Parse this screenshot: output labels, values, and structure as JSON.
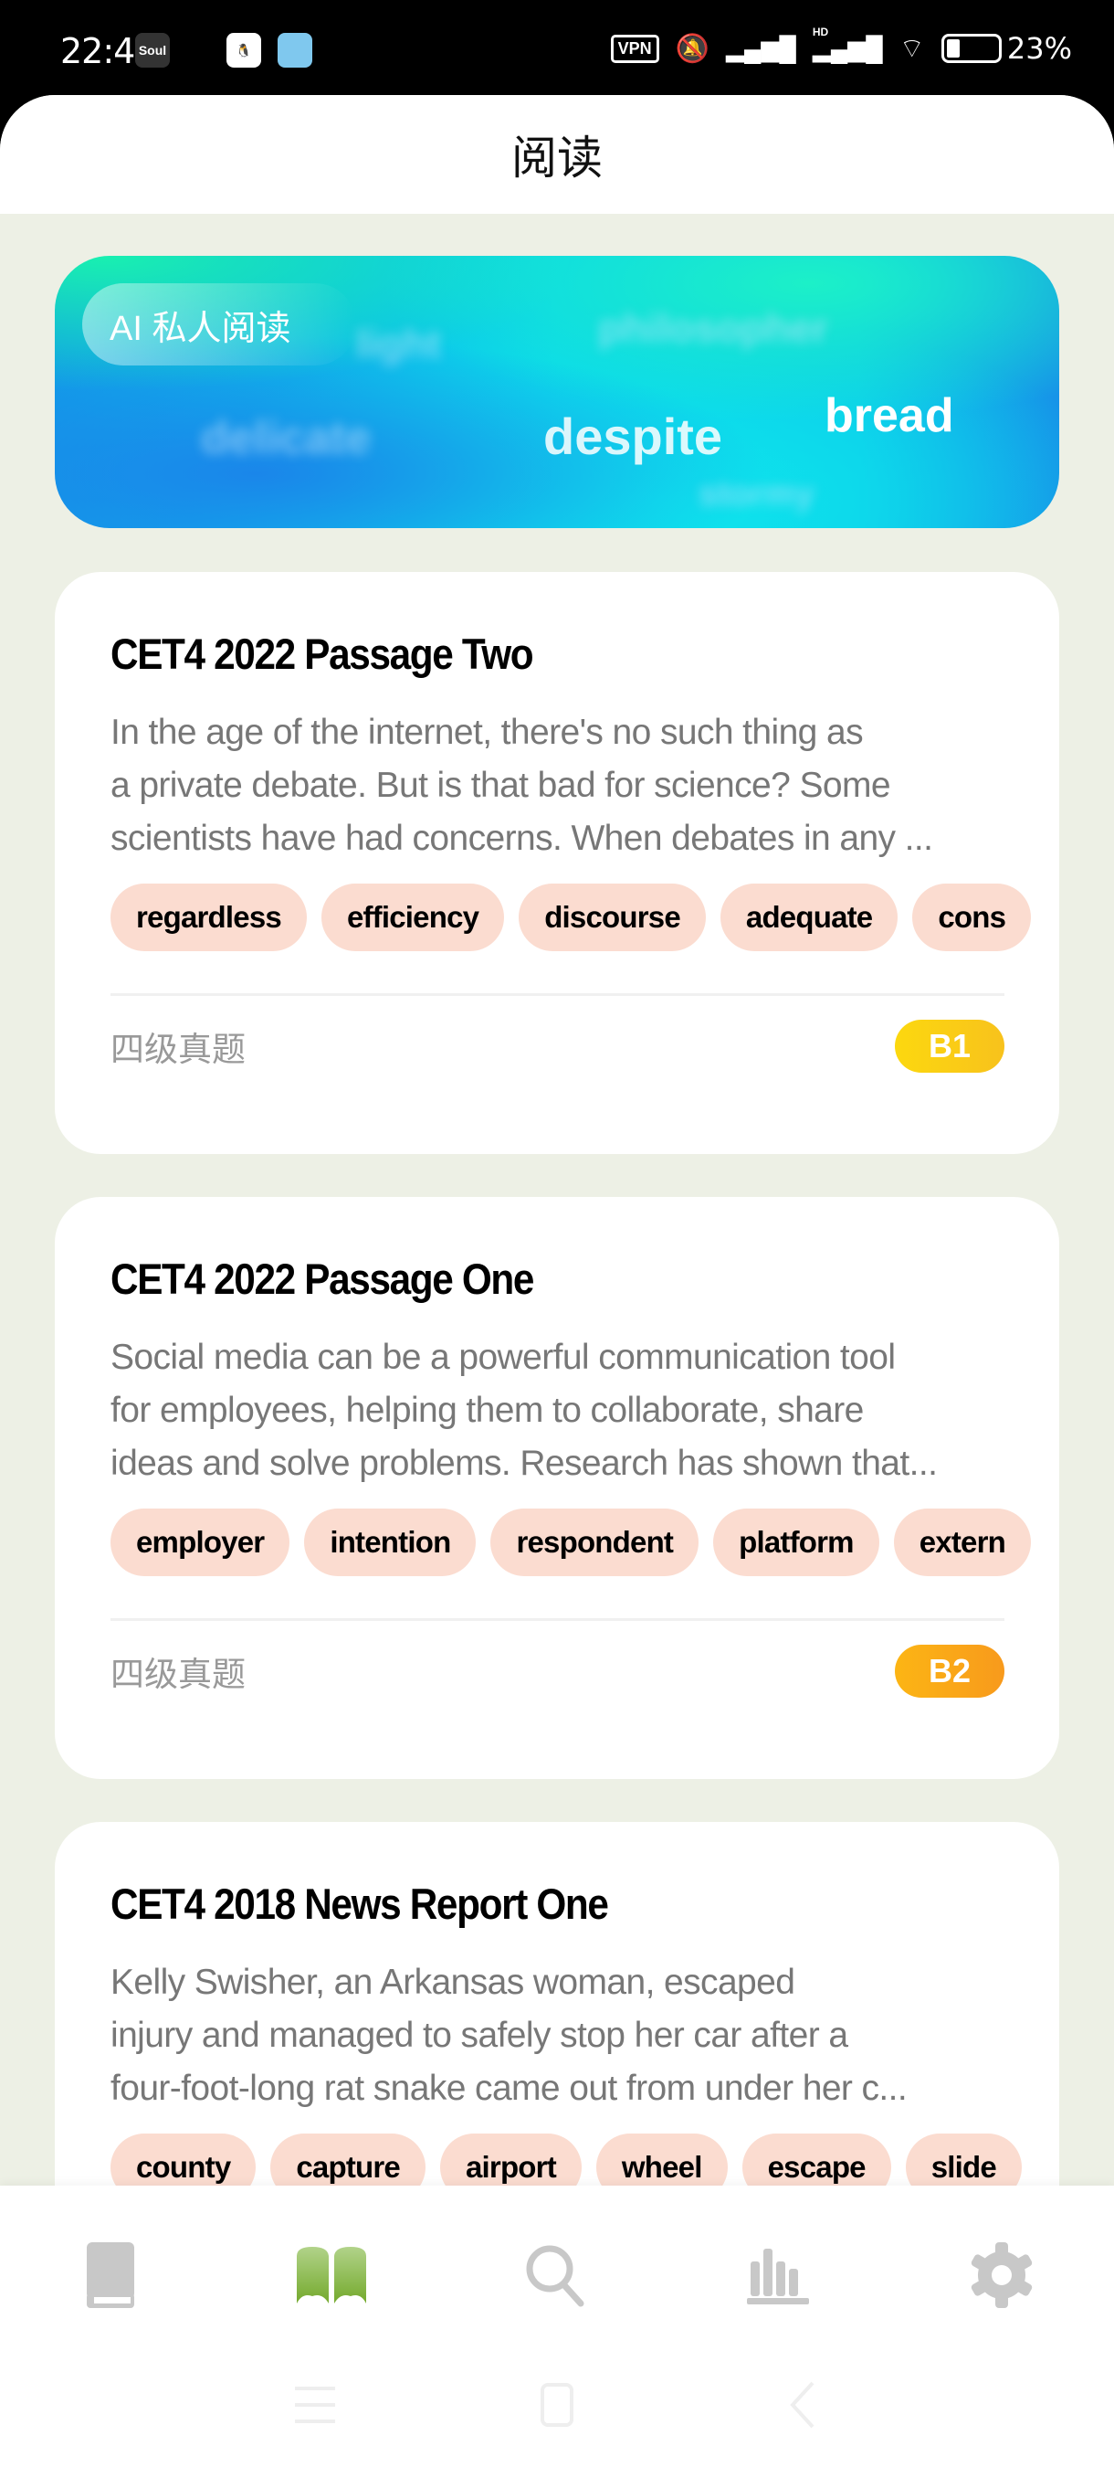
{
  "status_bar": {
    "time": "22:48",
    "apps": [
      "Soul",
      "QQ",
      "Bird"
    ],
    "vpn": "VPN",
    "hd": "HD",
    "battery": "23%"
  },
  "header": {
    "title": "阅读"
  },
  "banner": {
    "label": "AI 私人阅读",
    "words": [
      "light",
      "philosopher",
      "delicate",
      "despite",
      "bread",
      "stormy"
    ]
  },
  "cards": [
    {
      "title": "CET4 2022 Passage Two",
      "lines": [
        "In the age of the internet, there's no such thing as",
        "a private debate. But is that bad for science? Some",
        "scientists have had concerns. When debates in any ..."
      ],
      "chips": [
        "regardless",
        "efficiency",
        "discourse",
        "adequate",
        "cons"
      ],
      "category": "四级真题",
      "level": "B1",
      "level_color": "#fbc814"
    },
    {
      "title": "CET4 2022 Passage One",
      "lines": [
        "Social media can be a powerful communication tool",
        "for employees, helping them to collaborate, share",
        "ideas and solve problems. Research has shown that..."
      ],
      "chips": [
        "employer",
        "intention",
        "respondent",
        "platform",
        "extern"
      ],
      "category": "四级真题",
      "level": "B2",
      "level_color": "#fba515"
    },
    {
      "title": "CET4 2018 News Report One",
      "lines": [
        "Kelly Swisher, an Arkansas woman, escaped",
        "injury and managed to safely stop her car after a",
        "four-foot-long rat snake came out from under her c..."
      ],
      "chips": [
        "county",
        "capture",
        "airport",
        "wheel",
        "escape",
        "slide"
      ]
    }
  ],
  "tabs": [
    {
      "icon": "book-icon"
    },
    {
      "icon": "open-book-icon",
      "active": true
    },
    {
      "icon": "search-icon"
    },
    {
      "icon": "bar-chart-icon"
    },
    {
      "icon": "gear-icon"
    }
  ],
  "colors": {
    "accent": "#7db03a",
    "background": "#edf0e5",
    "chip": "#fbdcd0",
    "inactive_icon": "#c8c8c8"
  }
}
